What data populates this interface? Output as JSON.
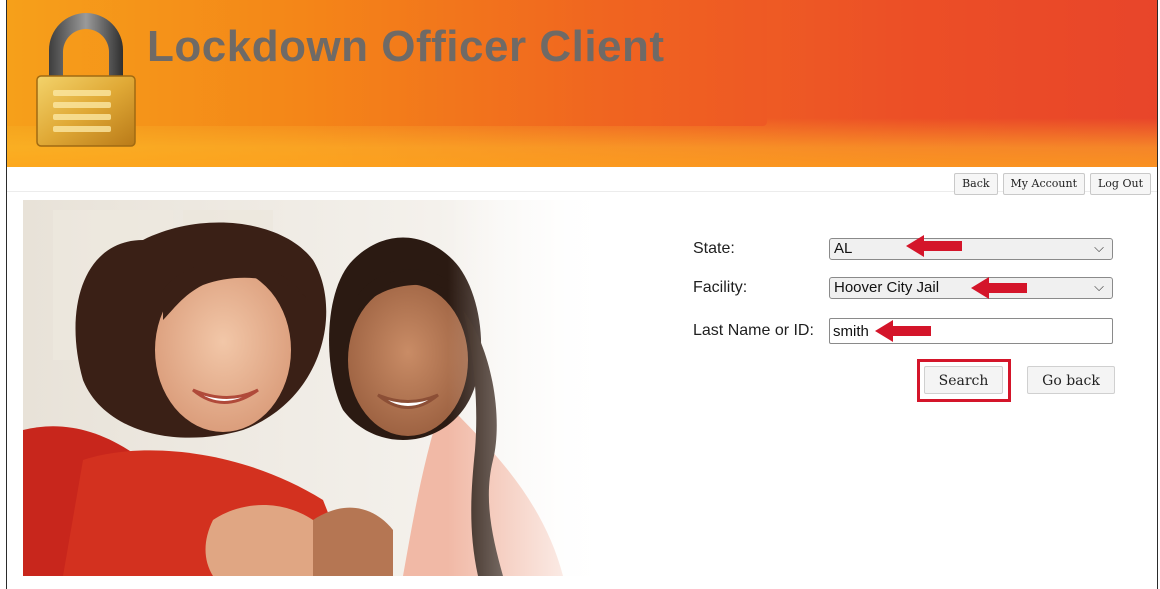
{
  "header": {
    "app_title": "Lockdown Officer Client",
    "logo_icon": "padlock-icon"
  },
  "nav": {
    "back_label": "Back",
    "my_account_label": "My Account",
    "logout_label": "Log Out"
  },
  "form": {
    "state_label": "State:",
    "state_value": "AL",
    "facility_label": "Facility:",
    "facility_value": "Hoover City Jail",
    "lastname_label": "Last Name or ID:",
    "lastname_value": "smith",
    "search_label": "Search",
    "goback_label": "Go back"
  },
  "colors": {
    "banner_orange": "#f48a1c",
    "banner_red": "#e8452a",
    "title_gray": "#6f6a66",
    "annotation_red": "#d4152a"
  }
}
